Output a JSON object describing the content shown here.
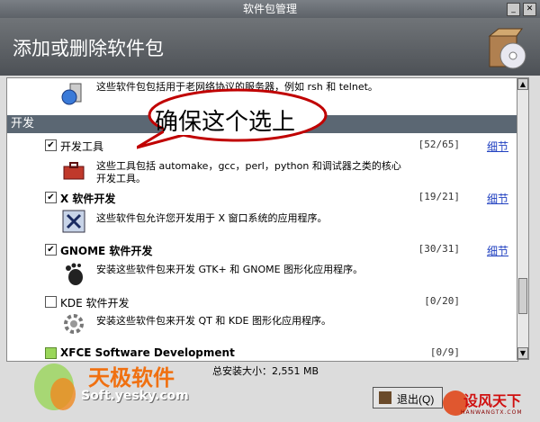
{
  "window": {
    "title": "软件包管理"
  },
  "header": {
    "title": "添加或删除软件包",
    "icon": "package-cd-icon"
  },
  "list": {
    "top_desc": "这些软件包包括用于老网络协议的服务器，例如 rsh 和 telnet。",
    "section_label": "开发",
    "packages": [
      {
        "name": "开发工具",
        "count": "[52/65]",
        "details": "细节",
        "checked": true,
        "desc": "这些工具包括 automake，gcc，perl，python 和调试器之类的核心开发工具。",
        "icon": "toolbox-icon"
      },
      {
        "name": "X 软件开发",
        "count": "[19/21]",
        "details": "细节",
        "checked": true,
        "desc": "这些软件包允许您开发用于 X 窗口系统的应用程序。",
        "icon": "x-window-icon"
      },
      {
        "name": "GNOME 软件开发",
        "count": "[30/31]",
        "details": "细节",
        "checked": true,
        "desc": "安装这些软件包来开发 GTK+ 和 GNOME 图形化应用程序。",
        "icon": "gnome-foot-icon"
      },
      {
        "name": "KDE 软件开发",
        "count": "[0/20]",
        "checked": false,
        "desc": "安装这些软件包来开发 QT 和 KDE 图形化应用程序。",
        "icon": "kde-gear-icon"
      },
      {
        "name": "XFCE Software Development",
        "count": "[0/9]",
        "checked": false
      }
    ]
  },
  "callout": {
    "text": "确保这个选上"
  },
  "footer": {
    "total": "总安装大小：2,551 MB",
    "quit_label": "退出(Q)"
  },
  "watermark": {
    "left_cn": "天极软件",
    "left_url": "Soft.yesky.com",
    "right_cn": "设风天下",
    "right_url": "HANWANGTX.COM"
  },
  "colors": {
    "section_bg": "#5b6773",
    "link": "#2040c0",
    "callout_border": "#c00000"
  }
}
